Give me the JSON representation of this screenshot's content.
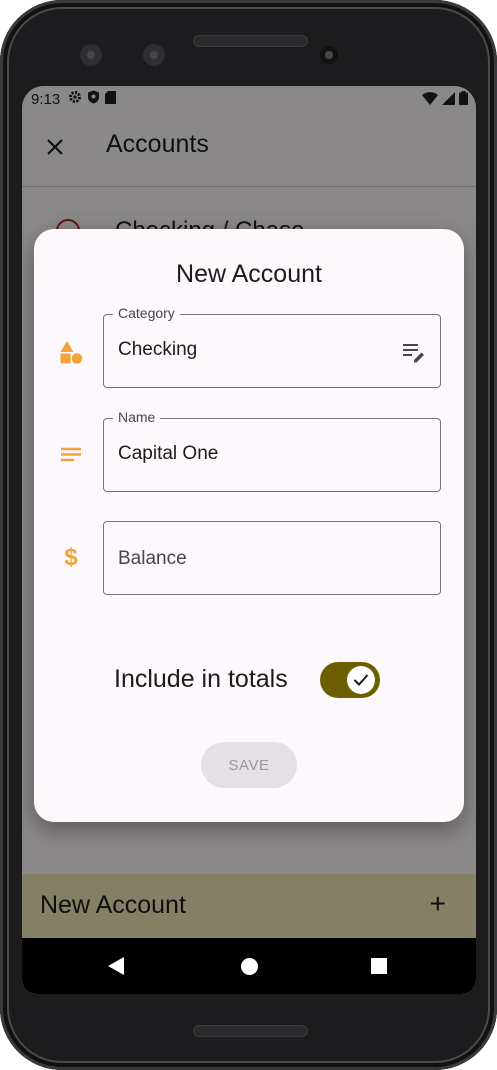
{
  "status_bar": {
    "time": "9:13"
  },
  "app_bar": {
    "title": "Accounts"
  },
  "background_list": {
    "items": [
      {
        "label": "Checking / Chase"
      }
    ]
  },
  "bottom_bar": {
    "new_account_label": "New Account"
  },
  "dialog": {
    "title": "New Account",
    "category": {
      "label": "Category",
      "value": "Checking"
    },
    "name": {
      "label": "Name",
      "value": "Capital One"
    },
    "balance": {
      "placeholder": "Balance"
    },
    "include_in_totals": {
      "label": "Include in totals",
      "checked": true
    },
    "save_label": "SAVE"
  },
  "icons": {
    "close": "close-icon",
    "category": "shapes-icon",
    "name": "notes-icon",
    "balance": "dollar-icon",
    "edit_list": "edit-list-icon",
    "add": "plus-icon",
    "error": "error-icon",
    "chevron": "chevron-right-icon"
  },
  "colors": {
    "accent_orange": "#f2a33a",
    "toggle_olive": "#6b5e00",
    "new_account_bar": "#f1e9b8",
    "error_red": "#b3261e"
  }
}
